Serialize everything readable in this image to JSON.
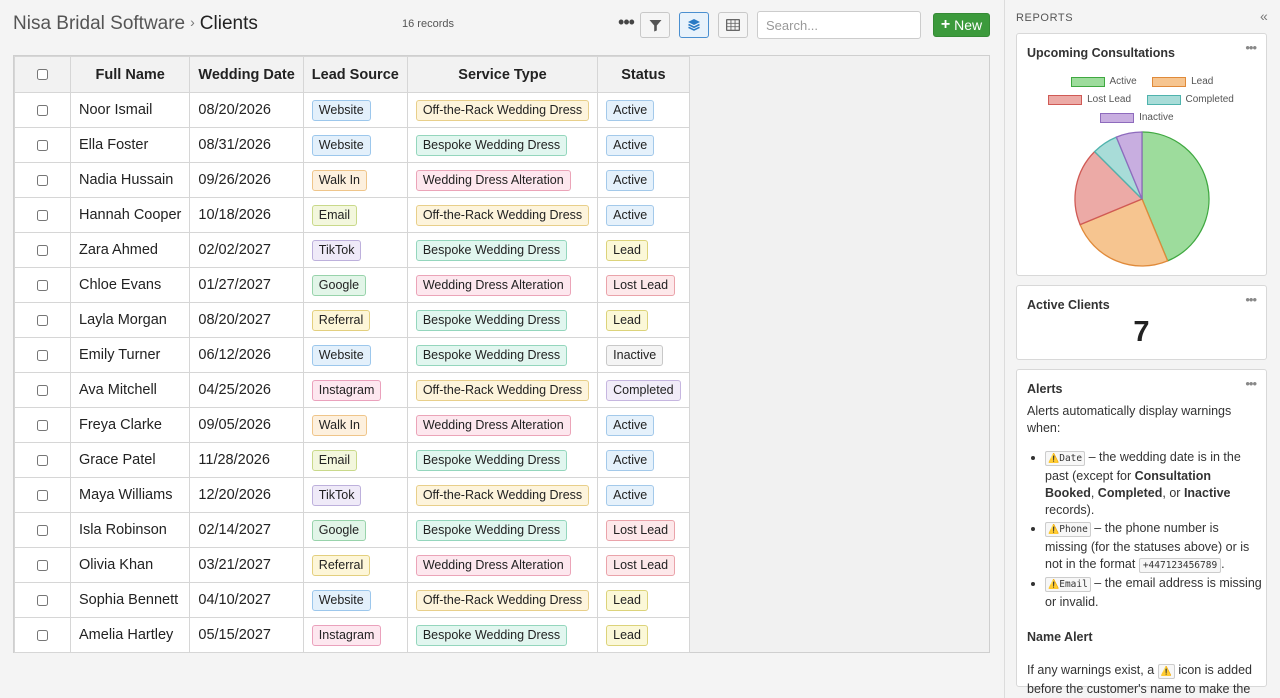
{
  "breadcrumb": {
    "app": "Nisa Bridal Software",
    "separator": "›",
    "page": "Clients"
  },
  "toolbar": {
    "record_count": "16 records",
    "more_label": "•••",
    "search_placeholder": "Search...",
    "new_label": "New"
  },
  "table": {
    "columns": [
      "Full Name",
      "Wedding Date",
      "Lead Source",
      "Service Type",
      "Status"
    ],
    "rows": [
      {
        "name": "Noor Ismail",
        "date": "08/20/2026",
        "source": "Website",
        "service": "Off-the-Rack Wedding Dress",
        "status": "Active"
      },
      {
        "name": "Ella Foster",
        "date": "08/31/2026",
        "source": "Website",
        "service": "Bespoke Wedding Dress",
        "status": "Active"
      },
      {
        "name": "Nadia Hussain",
        "date": "09/26/2026",
        "source": "Walk In",
        "service": "Wedding Dress Alteration",
        "status": "Active"
      },
      {
        "name": "Hannah Cooper",
        "date": "10/18/2026",
        "source": "Email",
        "service": "Off-the-Rack Wedding Dress",
        "status": "Active"
      },
      {
        "name": "Zara Ahmed",
        "date": "02/02/2027",
        "source": "TikTok",
        "service": "Bespoke Wedding Dress",
        "status": "Lead"
      },
      {
        "name": "Chloe Evans",
        "date": "01/27/2027",
        "source": "Google",
        "service": "Wedding Dress Alteration",
        "status": "Lost Lead"
      },
      {
        "name": "Layla Morgan",
        "date": "08/20/2027",
        "source": "Referral",
        "service": "Bespoke Wedding Dress",
        "status": "Lead"
      },
      {
        "name": "Emily Turner",
        "date": "06/12/2026",
        "source": "Website",
        "service": "Bespoke Wedding Dress",
        "status": "Inactive"
      },
      {
        "name": "Ava Mitchell",
        "date": "04/25/2026",
        "source": "Instagram",
        "service": "Off-the-Rack Wedding Dress",
        "status": "Completed"
      },
      {
        "name": "Freya Clarke",
        "date": "09/05/2026",
        "source": "Walk In",
        "service": "Wedding Dress Alteration",
        "status": "Active"
      },
      {
        "name": "Grace Patel",
        "date": "11/28/2026",
        "source": "Email",
        "service": "Bespoke Wedding Dress",
        "status": "Active"
      },
      {
        "name": "Maya Williams",
        "date": "12/20/2026",
        "source": "TikTok",
        "service": "Off-the-Rack Wedding Dress",
        "status": "Active"
      },
      {
        "name": "Isla Robinson",
        "date": "02/14/2027",
        "source": "Google",
        "service": "Bespoke Wedding Dress",
        "status": "Lost Lead"
      },
      {
        "name": "Olivia Khan",
        "date": "03/21/2027",
        "source": "Referral",
        "service": "Wedding Dress Alteration",
        "status": "Lost Lead"
      },
      {
        "name": "Sophia Bennett",
        "date": "04/10/2027",
        "source": "Website",
        "service": "Off-the-Rack Wedding Dress",
        "status": "Lead"
      },
      {
        "name": "Amelia Hartley",
        "date": "05/15/2027",
        "source": "Instagram",
        "service": "Bespoke Wedding Dress",
        "status": "Lead"
      }
    ]
  },
  "badge_colors": {
    "Website": {
      "bg": "#e3f0fb",
      "border": "#9cc7ec"
    },
    "Walk In": {
      "bg": "#fdf0de",
      "border": "#efc58a"
    },
    "Email": {
      "bg": "#f3f7dd",
      "border": "#c9d98a"
    },
    "TikTok": {
      "bg": "#efeaf8",
      "border": "#bdb0dc"
    },
    "Google": {
      "bg": "#e2f5e8",
      "border": "#98d3ab"
    },
    "Referral": {
      "bg": "#fdf6d8",
      "border": "#e3cf7e"
    },
    "Instagram": {
      "bg": "#fde7ef",
      "border": "#eaa1bc"
    },
    "Off-the-Rack Wedding Dress": {
      "bg": "#fdf4dc",
      "border": "#e8cf8a"
    },
    "Bespoke Wedding Dress": {
      "bg": "#e1f6ef",
      "border": "#94d6bd"
    },
    "Wedding Dress Alteration": {
      "bg": "#fde7ee",
      "border": "#eba4b8"
    },
    "Active": {
      "bg": "#e5f1fb",
      "border": "#a3c9ea"
    },
    "Lead": {
      "bg": "#fbf8d8",
      "border": "#dcd37a"
    },
    "Lost Lead": {
      "bg": "#fde8ea",
      "border": "#eaa3aa"
    },
    "Inactive": {
      "bg": "#f4f4f4",
      "border": "#c8c8c8"
    },
    "Completed": {
      "bg": "#f1ecf8",
      "border": "#c6b6e0"
    }
  },
  "reports": {
    "title": "REPORTS",
    "collapse_label": "«",
    "consultations": {
      "title": "Upcoming Consultations",
      "menu": "•••"
    },
    "active_clients": {
      "title": "Active Clients",
      "value": "7",
      "menu": "•••"
    },
    "alerts": {
      "title": "Alerts",
      "menu": "•••",
      "intro": "Alerts automatically display warnings when:",
      "date_tag": "Date",
      "date_text_1": " – the wedding date is in the past (except for ",
      "date_bold_1": "Consultation Booked",
      "date_text_2": ", ",
      "date_bold_2": "Completed",
      "date_text_3": ", or ",
      "date_bold_3": "Inactive",
      "date_text_4": " records).",
      "phone_tag": "Phone",
      "phone_text_1": " – the phone number is missing (for the statuses above) or is not in the format ",
      "phone_format": "+447123456789",
      "phone_text_2": ".",
      "email_tag": "Email",
      "email_text": " – the email address is missing or invalid.",
      "name_alert_title": "Name Alert",
      "name_alert_text_1": "If any warnings exist, a ",
      "name_alert_text_2": " icon is added before the customer's name to make the record stand out.",
      "warn_glyph": "⚠️"
    }
  },
  "chart_data": {
    "type": "pie",
    "title": "Upcoming Consultations",
    "legend_placement": "top",
    "series": [
      {
        "name": "Active",
        "value": 7,
        "color": "#9ddc9c",
        "border": "#3fa840"
      },
      {
        "name": "Lead",
        "value": 4,
        "color": "#f6c590",
        "border": "#e08a3a"
      },
      {
        "name": "Lost Lead",
        "value": 3,
        "color": "#ecaaa6",
        "border": "#d05a55"
      },
      {
        "name": "Completed",
        "value": 1,
        "color": "#a8dcd8",
        "border": "#4fb3ad"
      },
      {
        "name": "Inactive",
        "value": 1,
        "color": "#c8aee0",
        "border": "#8e6bbd"
      }
    ]
  }
}
